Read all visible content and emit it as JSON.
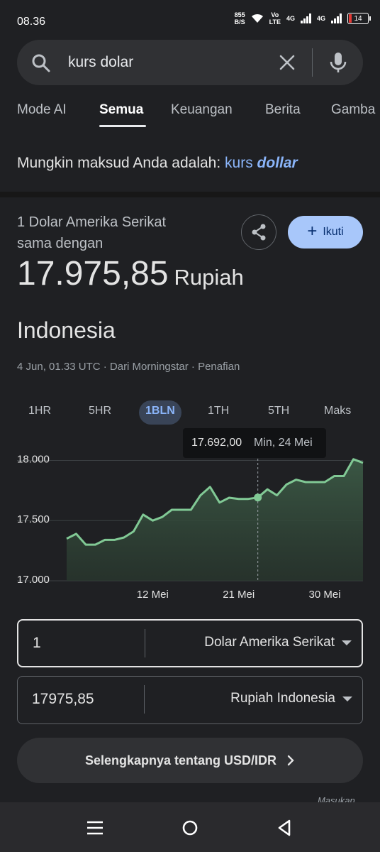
{
  "status_bar": {
    "time": "08.36",
    "net_speed_value": "855",
    "net_speed_unit": "B/S",
    "volte_top": "Vo",
    "volte_bottom": "LTE",
    "network_1": "4G",
    "network_2": "4G",
    "battery": "14"
  },
  "search": {
    "query": "kurs dolar"
  },
  "tabs": [
    "Mode AI",
    "Semua",
    "Keuangan",
    "Berita",
    "Gamba"
  ],
  "active_tab": "Semua",
  "suggestion": {
    "prefix": "Mungkin maksud Anda adalah: ",
    "link_plain": "kurs ",
    "link_emphasis": "dollar"
  },
  "converter": {
    "label_line1": "1 Dolar Amerika Serikat",
    "label_line2": "sama dengan",
    "rate": "17.975,85",
    "rate_currency": "Rupiah",
    "region": "Indonesia",
    "meta": "4 Jun, 01.33 UTC · Dari Morningstar · Penafian",
    "follow_label": "Ikuti",
    "from_amount": "1",
    "from_currency": "Dolar Amerika Serikat",
    "to_amount": "17975,85",
    "to_currency": "Rupiah Indonesia",
    "more_label": "Selengkapnya tentang USD/IDR",
    "feedback": "Masukan"
  },
  "ranges": [
    "1HR",
    "5HR",
    "1BLN",
    "1TH",
    "5TH",
    "Maks"
  ],
  "active_range": "1BLN",
  "tooltip": {
    "value": "17.692,00",
    "date": "Min, 24 Mei"
  },
  "colors": {
    "line": "#81c995",
    "area_top": "#3c5a46",
    "accent": "#8ab4f8",
    "follow_bg": "#a8c7fa"
  },
  "chart_data": {
    "type": "line",
    "y_ticks": [
      "18.000",
      "17.500",
      "17.000"
    ],
    "y_tick_values": [
      18000,
      17500,
      17000
    ],
    "x_ticks": [
      "12 Mei",
      "21 Mei",
      "30 Mei"
    ],
    "x_tick_positions": [
      9,
      18,
      27
    ],
    "ylim": [
      17000,
      18050
    ],
    "xlim": [
      0,
      31
    ],
    "grid": true,
    "x": [
      0,
      1,
      2,
      3,
      4,
      5,
      6,
      7,
      8,
      9,
      10,
      11,
      12,
      13,
      14,
      15,
      16,
      17,
      18,
      19,
      20,
      21,
      22,
      23,
      24,
      25,
      26,
      27,
      28,
      29,
      30,
      31
    ],
    "values": [
      17350,
      17390,
      17300,
      17300,
      17340,
      17340,
      17360,
      17410,
      17550,
      17500,
      17530,
      17590,
      17590,
      17590,
      17710,
      17780,
      17650,
      17690,
      17680,
      17680,
      17692,
      17760,
      17710,
      17800,
      17840,
      17820,
      17820,
      17820,
      17870,
      17870,
      18010,
      17980
    ],
    "highlight_index": 20
  }
}
